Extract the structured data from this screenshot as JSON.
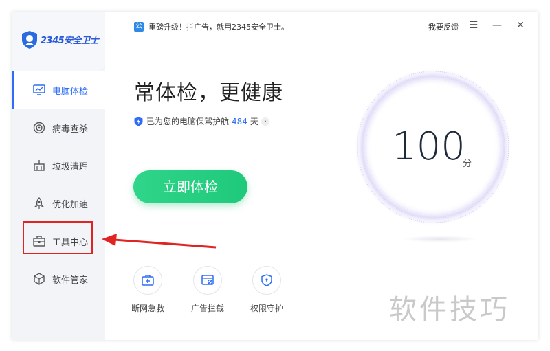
{
  "app": {
    "brand": "2345安全卫士"
  },
  "notice": {
    "icon": "公",
    "text": "重磅升级！拦广告，就用2345安全卫士。"
  },
  "titlebar": {
    "feedback": "我要反馈",
    "menu_icon": "menu-icon",
    "minimize_icon": "minimize-icon",
    "close_icon": "close-icon"
  },
  "sidebar": {
    "items": [
      {
        "label": "电脑体检",
        "icon": "monitor-icon",
        "active": true
      },
      {
        "label": "病毒查杀",
        "icon": "target-icon"
      },
      {
        "label": "垃圾清理",
        "icon": "broom-icon"
      },
      {
        "label": "优化加速",
        "icon": "rocket-icon"
      },
      {
        "label": "工具中心",
        "icon": "toolbox-icon",
        "highlighted": true
      },
      {
        "label": "软件管家",
        "icon": "box-icon"
      }
    ]
  },
  "main": {
    "headline": "常体检，更健康",
    "protect_text": "已为您的电脑保驾护航",
    "protect_days": "484",
    "protect_unit": "天",
    "scan_button": "立即体检",
    "score": "100",
    "score_unit": "分",
    "tools": [
      {
        "label": "断网急救",
        "icon": "first-aid-icon"
      },
      {
        "label": "广告拦截",
        "icon": "ad-block-icon"
      },
      {
        "label": "权限守护",
        "icon": "shield-icon"
      }
    ]
  },
  "watermark": "软件技巧",
  "colors": {
    "accent": "#2f6df6",
    "scan_green": "#22cc7e",
    "annotation_red": "#e02424"
  }
}
